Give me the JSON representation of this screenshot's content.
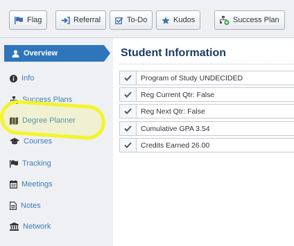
{
  "toolbar": {
    "buttons": [
      {
        "label": "Flag",
        "icon": "flag-icon"
      },
      {
        "label": "Referral",
        "icon": "referral-icon"
      },
      {
        "label": "To-Do",
        "icon": "todo-checkbox-icon"
      },
      {
        "label": "Kudos",
        "icon": "star-icon"
      },
      {
        "label": "Success Plan",
        "icon": "success-plan-icon"
      }
    ]
  },
  "sidebar": {
    "items": [
      {
        "label": "Overview",
        "icon": "user-icon",
        "active": true
      },
      {
        "label": "Info",
        "icon": "info-icon"
      },
      {
        "label": "Success Plans",
        "icon": "sitemap-icon"
      },
      {
        "label": "Degree Planner",
        "icon": "map-icon"
      },
      {
        "label": "Courses",
        "icon": "graduation-cap-icon"
      },
      {
        "label": "Tracking",
        "icon": "flag-icon"
      },
      {
        "label": "Meetings",
        "icon": "calendar-icon"
      },
      {
        "label": "Notes",
        "icon": "notes-icon"
      },
      {
        "label": "Network",
        "icon": "institution-icon"
      }
    ]
  },
  "main": {
    "title": "Student Information",
    "rows": [
      {
        "text": "Program of Study UNDECIDED"
      },
      {
        "text": "Reg Current Qtr: False"
      },
      {
        "text": "Reg Next Qtr: False"
      },
      {
        "text": "Cumulative GPA 3.54"
      },
      {
        "text": "Credits Earned 26.00"
      }
    ]
  },
  "colors": {
    "accent": "#2f75bb",
    "link": "#3f7cb8",
    "highlight": "#f3f52a",
    "title": "#1d3c5f",
    "panel": "#eef0f3"
  }
}
